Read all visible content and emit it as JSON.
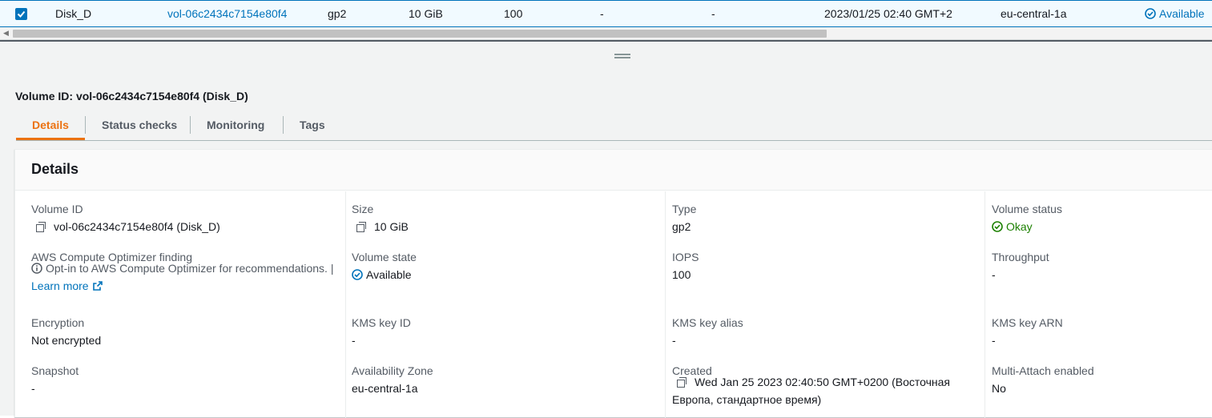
{
  "table_row": {
    "name": "Disk_D",
    "volume_id": "vol-06c2434c7154e80f4",
    "type": "gp2",
    "size": "10 GiB",
    "iops": "100",
    "throughput": "-",
    "snapshot": "-",
    "created": "2023/01/25 02:40 GMT+2",
    "az": "eu-central-1a",
    "state": "Available"
  },
  "panel": {
    "title": "Volume ID: vol-06c2434c7154e80f4 (Disk_D)",
    "tabs": [
      "Details",
      "Status checks",
      "Monitoring",
      "Tags"
    ]
  },
  "details": {
    "heading": "Details",
    "fields": {
      "volume_id": {
        "label": "Volume ID",
        "value": "vol-06c2434c7154e80f4 (Disk_D)"
      },
      "size": {
        "label": "Size",
        "value": "10 GiB"
      },
      "type": {
        "label": "Type",
        "value": "gp2"
      },
      "volume_status": {
        "label": "Volume status",
        "value": "Okay"
      },
      "optimizer": {
        "label": "AWS Compute Optimizer finding",
        "value": "Opt-in to AWS Compute Optimizer for recommendations. |",
        "link": "Learn more"
      },
      "volume_state": {
        "label": "Volume state",
        "value": "Available"
      },
      "iops": {
        "label": "IOPS",
        "value": "100"
      },
      "throughput": {
        "label": "Throughput",
        "value": "-"
      },
      "encryption": {
        "label": "Encryption",
        "value": "Not encrypted"
      },
      "kms_key_id": {
        "label": "KMS key ID",
        "value": "-"
      },
      "kms_key_alias": {
        "label": "KMS key alias",
        "value": "-"
      },
      "kms_key_arn": {
        "label": "KMS key ARN",
        "value": "-"
      },
      "snapshot": {
        "label": "Snapshot",
        "value": "-"
      },
      "availability_zone": {
        "label": "Availability Zone",
        "value": "eu-central-1a"
      },
      "created": {
        "label": "Created",
        "value": "Wed Jan 25 2023 02:40:50 GMT+0200 (Восточная Европа, стандартное время)"
      },
      "multi_attach": {
        "label": "Multi-Attach enabled",
        "value": "No"
      }
    }
  },
  "colors": {
    "link": "#0073bb",
    "active_tab": "#ec7211",
    "success": "#1d8102"
  }
}
